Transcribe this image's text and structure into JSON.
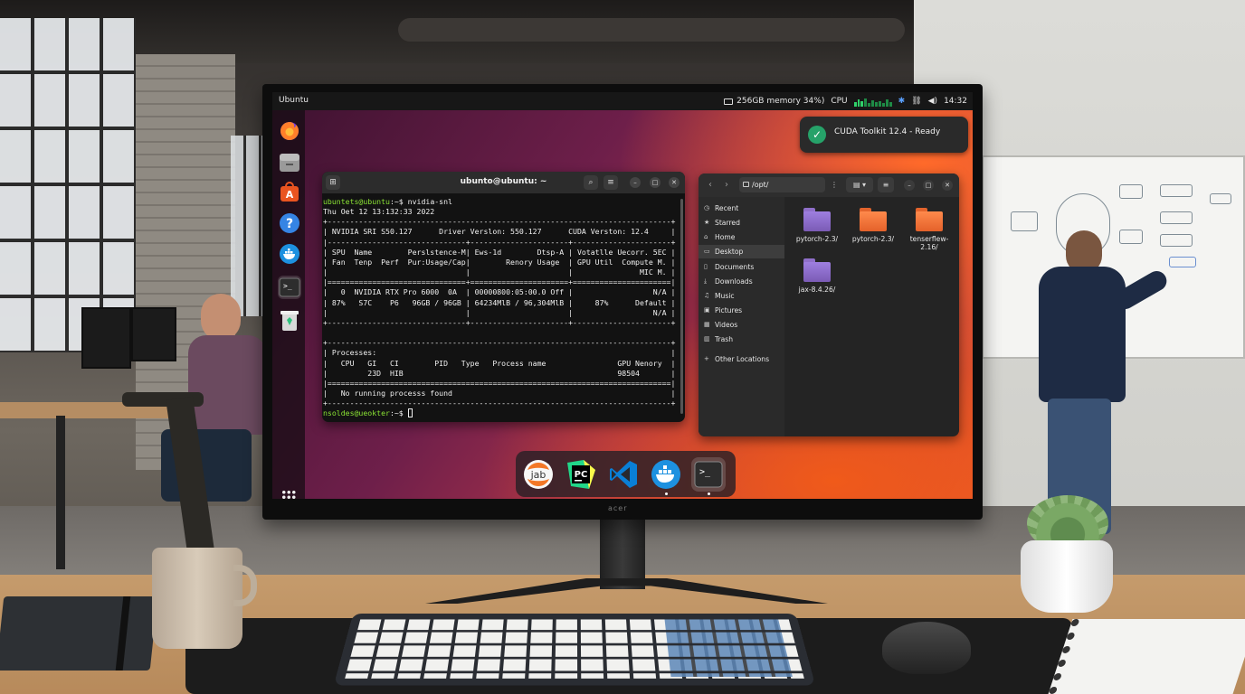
{
  "topbar": {
    "app_name": "Ubuntu",
    "memory": "256GB memory 34%)",
    "cpu_label": "CPU",
    "clock": "14:32"
  },
  "notification": {
    "text": "CUDA Toolkit 12.4 - Ready",
    "icon": "check-icon"
  },
  "terminal": {
    "title": "ubunto@ubuntu: ~",
    "prompt1_user": "ubuntets@ubuntu",
    "prompt1_rest": ":~$ nvidia-snl",
    "lines": [
      "Thu Oet 12 13:132:33 2022",
      "+-----------------------------------------------------------------------------+",
      "| NVIDIA SRI S50.127      Driver Verslon: 550.127      CUDA Verston: 12.4     |",
      "|-------------------------------+----------------------+----------------------+",
      "| SPU  Name        Perslstence-M| Ews-1d        Dtsp-A | Votatlle Uecorr. 5EC |",
      "| Fan  Tenp  Perf  Pur:Usage/Cap|        Renory Usage  | GPU Util  Compute M. |",
      "|                               |                      |               MIC M. |",
      "|===============================+======================+======================|",
      "|   0  NVIDIA RTX Pro 6000  0A  | 00000800:05:00.0 Off |                  N/A |",
      "| 87%   S7C    P6   96GB / 96GB | 64234MlB / 96,304MlB |     87%      Default |",
      "|                               |                      |                  N/A |",
      "+-------------------------------+----------------------+----------------------+",
      "",
      "+-----------------------------------------------------------------------------+",
      "| Processes:                                                                  |",
      "|   CPU   GI   CI        PID   Type   Process name                GPU Nenory  |",
      "|         23D  HIB                                                98504       |",
      "|=============================================================================|",
      "|   No running processs found                                                 |",
      "+-----------------------------------------------------------------------------+"
    ],
    "prompt2_user": "nsoldes@ueokter",
    "prompt2_rest": ":~$ "
  },
  "files": {
    "path": "/opt/",
    "sidebar": [
      "Recent",
      "Starred",
      "Home",
      "Desktop",
      "Documents",
      "Downloads",
      "Music",
      "Pictures",
      "Videos",
      "Trash",
      "Other Locations"
    ],
    "sidebar_icons": [
      "clock-icon",
      "star-icon",
      "home-icon",
      "desktop-icon",
      "document-icon",
      "download-icon",
      "music-icon",
      "pictures-icon",
      "video-icon",
      "trash-icon",
      "plus-icon"
    ],
    "active_item": "Desktop",
    "folders": [
      {
        "name": "pytorch-2.3/",
        "color": "#8f6fc9"
      },
      {
        "name": "pytorch-2.3/",
        "color": "#ff8a4c"
      },
      {
        "name": "tenserflew-2.16/",
        "color": "#ff8a4c"
      },
      {
        "name": "jax-8.4.26/",
        "color": "#8f6fc9"
      }
    ]
  },
  "dock_left": [
    "firefox-icon",
    "files-icon",
    "app-center-icon",
    "help-icon",
    "docker-icon",
    "terminal-icon",
    "trash-icon",
    "show-apps-icon"
  ],
  "dock_bottom": [
    {
      "icon": "jupyter-icon",
      "label": "jab"
    },
    {
      "icon": "pycharm-icon",
      "label": "PC"
    },
    {
      "icon": "vscode-icon",
      "label": ""
    },
    {
      "icon": "docker-icon",
      "label": ""
    },
    {
      "icon": "terminal-icon",
      "label": ">_"
    }
  ],
  "monitor_brand": "acer",
  "colors": {
    "accent_orange": "#e95420",
    "prompt_green": "#8ae234",
    "success_green": "#26a269"
  }
}
